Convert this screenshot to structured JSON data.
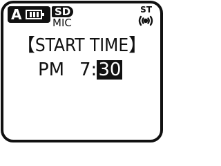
{
  "status": {
    "folder": "A",
    "battery_level": 0.75,
    "media": "SD",
    "input": "MIC",
    "channel_mode": "ST",
    "mic_icon": "mic-sensitivity-icon"
  },
  "screen": {
    "title": "【START TIME】",
    "meridiem": "PM",
    "hour": "7",
    "colon": ":",
    "minute": "30",
    "selected_field": "minute"
  }
}
